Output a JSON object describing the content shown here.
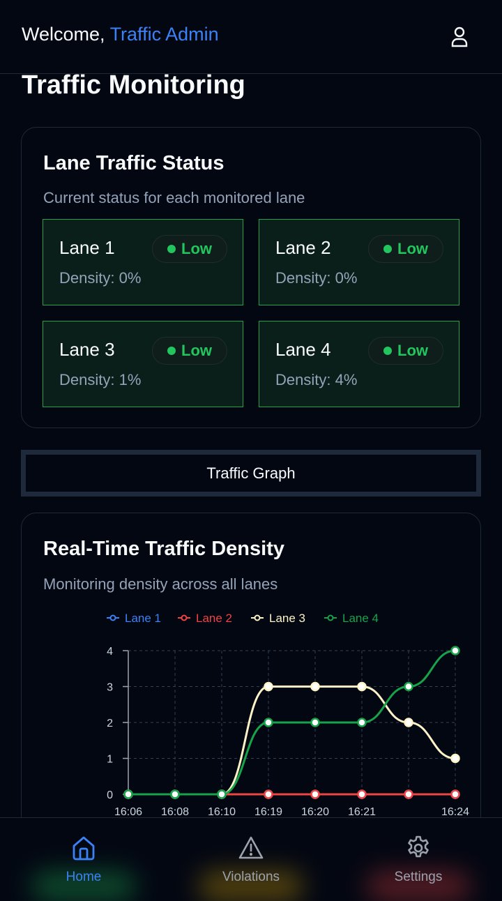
{
  "header": {
    "greeting": "Welcome,",
    "user_name": "Traffic Admin",
    "user_icon": "user-icon"
  },
  "page": {
    "title": "Traffic Monitoring"
  },
  "status_card": {
    "title": "Lane Traffic Status",
    "subtitle": "Current status for each monitored lane",
    "lanes": [
      {
        "name": "Lane 1",
        "status": "Low",
        "density": "Density: 0%"
      },
      {
        "name": "Lane 2",
        "status": "Low",
        "density": "Density: 0%"
      },
      {
        "name": "Lane 3",
        "status": "Low",
        "density": "Density: 1%"
      },
      {
        "name": "Lane 4",
        "status": "Low",
        "density": "Density: 4%"
      }
    ],
    "status_color": "#22c55e"
  },
  "graph_button": {
    "label": "Traffic Graph"
  },
  "chart_card": {
    "title": "Real-Time Traffic Density",
    "subtitle": "Monitoring density across all lanes"
  },
  "chart_data": {
    "type": "line",
    "x": [
      "16:06",
      "16:08",
      "16:10",
      "16:19",
      "16:20",
      "16:21",
      "",
      "16:24"
    ],
    "series": [
      {
        "name": "Lane 1",
        "color": "#3b82f6",
        "values": [
          0,
          0,
          0,
          0,
          0,
          0,
          0,
          0
        ]
      },
      {
        "name": "Lane 2",
        "color": "#ef4444",
        "values": [
          0,
          0,
          0,
          0,
          0,
          0,
          0,
          0
        ]
      },
      {
        "name": "Lane 3",
        "color": "#fef3c7",
        "values": [
          0,
          0,
          0,
          3,
          3,
          3,
          2,
          1
        ]
      },
      {
        "name": "Lane 4",
        "color": "#16a34a",
        "values": [
          0,
          0,
          0,
          2,
          2,
          2,
          3,
          4
        ]
      }
    ],
    "yticks": [
      0,
      1,
      2,
      3,
      4
    ],
    "ylim": [
      0,
      4
    ],
    "grid": true,
    "legend": "top"
  },
  "nav": {
    "items": [
      {
        "label": "Home",
        "icon": "home-icon",
        "active": true
      },
      {
        "label": "Violations",
        "icon": "warning-icon",
        "active": false
      },
      {
        "label": "Settings",
        "icon": "gear-icon",
        "active": false
      }
    ]
  }
}
